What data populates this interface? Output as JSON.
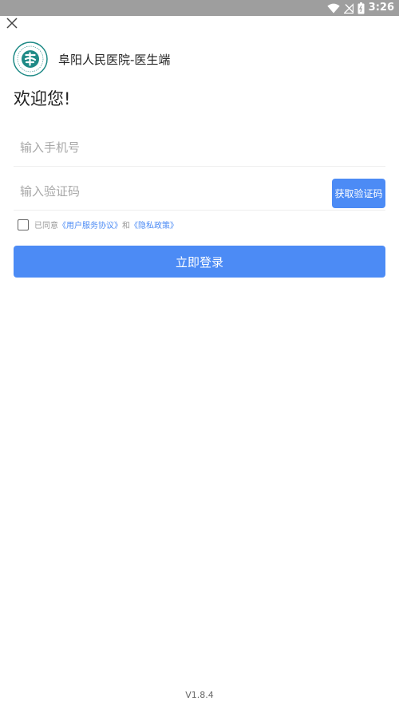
{
  "status_bar": {
    "time": "3:26",
    "icons": [
      "wifi-icon",
      "signal-icon",
      "battery-icon"
    ]
  },
  "header": {
    "close_icon": "close-icon",
    "logo_icon": "hospital-logo-icon",
    "title": "阜阳人民医院-医生端"
  },
  "welcome": "欢迎您!",
  "form": {
    "phone_placeholder": "输入手机号",
    "code_placeholder": "输入验证码",
    "get_code_label": "获取验证码",
    "login_label": "立即登录"
  },
  "agreement": {
    "prefix": "已同意",
    "user_agreement": "《用户服务协议》",
    "and": "和",
    "privacy_policy": "《隐私政策》",
    "checked": false
  },
  "version": "V1.8.4",
  "colors": {
    "accent": "#4c8bf5",
    "status_bar": "#9e9e9e",
    "logo": "#1e8a86"
  }
}
